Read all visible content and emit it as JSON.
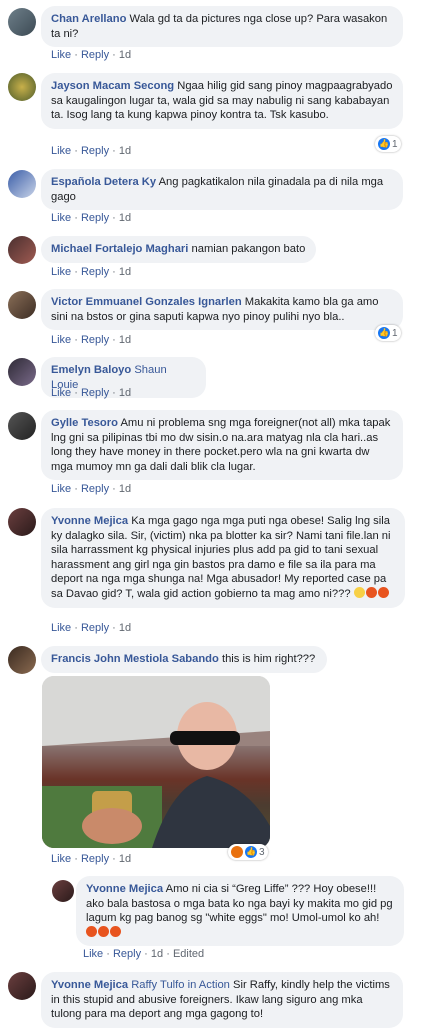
{
  "actions": {
    "like": "Like",
    "reply": "Reply",
    "dot": "·",
    "edited": "Edited"
  },
  "comments": [
    {
      "name": "Chan Arellano",
      "text": "Wala gd ta da pictures nga close up? Para wasakon ta ni?",
      "time": "1d"
    },
    {
      "name": "Jayson Macam Secong",
      "text": "Ngaa hilig gid sang pinoy magpaagrabyado sa kaugalingon lugar ta, wala gid sa may nabulig ni sang kababayan ta. Isog lang ta kung kapwa pinoy kontra ta. Tsk kasubo.",
      "time": "1d",
      "reactions": "1"
    },
    {
      "name": "Española Detera Ky",
      "text": "Ang pagkatikalon nila ginadala pa di nila mga gago",
      "time": "1d"
    },
    {
      "name": "Michael Fortalejo Maghari",
      "text": "namian pakangon bato",
      "time": "1d"
    },
    {
      "name": "Victor Emmuanel Gonzales Ignarlen",
      "text": "Makakita kamo bla ga amo sini na bstos or gina saputi kapwa nyo pinoy pulihi nyo bla..",
      "time": "1d",
      "reactions": "1"
    },
    {
      "name": "Emelyn Baloyo",
      "mention": "Shaun Louie",
      "text": "",
      "time": "1d"
    },
    {
      "name": "Gylle Tesoro",
      "text": "Amu ni problema sng mga foreigner(not all) mka tapak lng gni sa pilipinas tbi mo dw sisin.o na.ara matyag nla cla hari..as long they have money in there pocket.pero wla na gni kwarta dw mga mumoy mn ga dali dali blik cla lugar.",
      "time": "1d"
    },
    {
      "name": "Yvonne Mejica",
      "text": "Ka mga gago nga mga puti nga obese! Salig lng sila ky dalagko sila. Sir, (victim) nka pa blotter ka sir? Nami tani file.lan ni sila harrassment kg physical injuries plus add pa gid to tani sexual harassment ang girl nga gin bastos pra damo e file sa ila para ma deport na nga mga shunga na! Mga abusador! My reported case pa sa Davao gid? T, wala gid action gobierno ta mag amo ni???",
      "time": "1d"
    },
    {
      "name": "Francis John Mestiola Sabando",
      "text": "this is him right???",
      "time": "1d",
      "reactions": "3"
    },
    {
      "name": "Yvonne Mejica",
      "text": "Amo ni cia si “Greg Liffe” ??? Hoy obese!!! ako bala bastosa o mga bata ko nga bayi ky makita mo gid pg lagum kg pag banog sg \"white eggs\" mo! Umol-umol ko ah!",
      "time": "1d"
    },
    {
      "name": "Yvonne Mejica",
      "mention": "Raffy Tulfo in Action",
      "text": "Sir Raffy, kindly help the victims in this stupid and abusive foreigners. Ikaw lang siguro ang mka tulong para ma deport ang mga gagong to!"
    }
  ],
  "colors": {
    "name": "#385898",
    "bubble": "#f0f2f5",
    "text": "#1c1e21",
    "meta": "#606770",
    "like": "#1877f2"
  }
}
